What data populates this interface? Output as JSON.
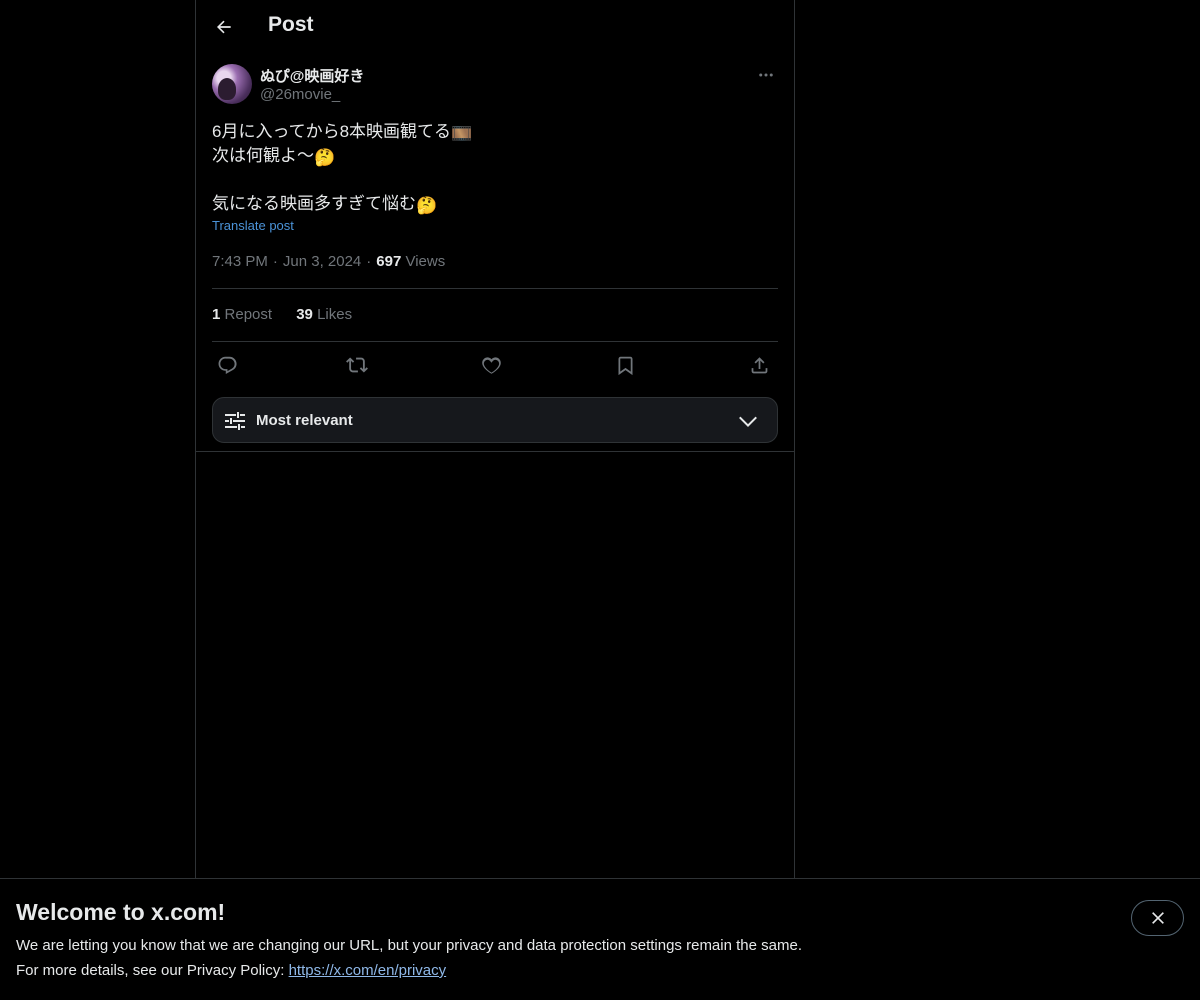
{
  "header": {
    "title": "Post",
    "back_icon": "arrow-left-icon"
  },
  "author": {
    "display_name": "ぬぴ@映画好き",
    "handle": "@26movie_"
  },
  "post": {
    "line1": "6月に入ってから8本映画観てる",
    "line1_emoji": "🎞️",
    "line2": "次は何観よ〜",
    "line2_emoji": "🤔",
    "line3": "気になる映画多すぎて悩む",
    "line3_emoji": "🤔",
    "translate_label": "Translate post"
  },
  "meta": {
    "time": "7:43 PM",
    "date": "Jun 3, 2024",
    "views_count": "697",
    "views_label": "Views"
  },
  "stats": {
    "reposts_count": "1",
    "reposts_label": "Repost",
    "likes_count": "39",
    "likes_label": "Likes"
  },
  "actions": [
    "reply-icon",
    "repost-icon",
    "like-icon",
    "bookmark-icon",
    "share-icon"
  ],
  "sort": {
    "label": "Most relevant"
  },
  "banner": {
    "title": "Welcome to x.com!",
    "line1": "We are letting you know that we are changing our URL, but your privacy and data protection settings remain the same.",
    "line2_prefix": "For more details, see our Privacy Policy: ",
    "link": "https://x.com/en/privacy"
  },
  "colors": {
    "background": "#000000",
    "link": "#4b93d8",
    "muted": "#71767b",
    "border": "#2f3336"
  }
}
